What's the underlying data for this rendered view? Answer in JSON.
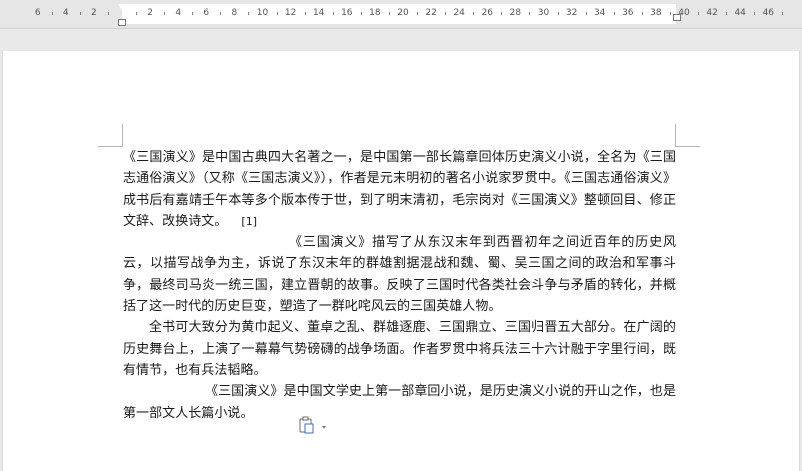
{
  "ruler": {
    "numbers": [
      "6",
      "4",
      "2",
      "2",
      "4",
      "6",
      "8",
      "10",
      "12",
      "14",
      "16",
      "18",
      "20",
      "22",
      "24",
      "26",
      "28",
      "30",
      "32",
      "34",
      "36",
      "38",
      "40",
      "42",
      "44",
      "46"
    ]
  },
  "document": {
    "paragraphs": [
      {
        "text": "《三国演义》是中国古典四大名著之一，是中国第一部长篇章回体历史演义小说，全名为《三国志通俗演义》（又称《三国志演义》），作者是元末明初的著名小说家罗贯中。《三国志通俗演义》成书后有嘉靖壬午本等多个版本传于世，到了明末清初，毛宗岗对《三国演义》整顿回目、修正文辞、改换诗文。",
        "ref": "[1]"
      },
      {
        "text": "《三国演义》描写了从东汉末年到西晋初年之间近百年的历史风云，以描写战争为主，诉说了东汉末年的群雄割据混战和魏、蜀、吴三国之间的政治和军事斗争，最终司马炎一统三国，建立晋朝的故事。反映了三国时代各类社会斗争与矛盾的转化，并概括了这一时代的历史巨变，塑造了一群叱咤风云的三国英雄人物。"
      },
      {
        "text": "全书可大致分为黄巾起义、董卓之乱、群雄逐鹿、三国鼎立、三国归晋五大部分。在广阔的历史舞台上，上演了一幕幕气势磅礴的战争场面。作者罗贯中将兵法三十六计融于字里行间，既有情节，也有兵法韬略。"
      },
      {
        "text": "《三国演义》是中国文学史上第一部章回小说，是历史演义小说的开山之作，也是第一部文人长篇小说。"
      }
    ]
  },
  "icons": {
    "paste_options": "paste-options-icon"
  }
}
